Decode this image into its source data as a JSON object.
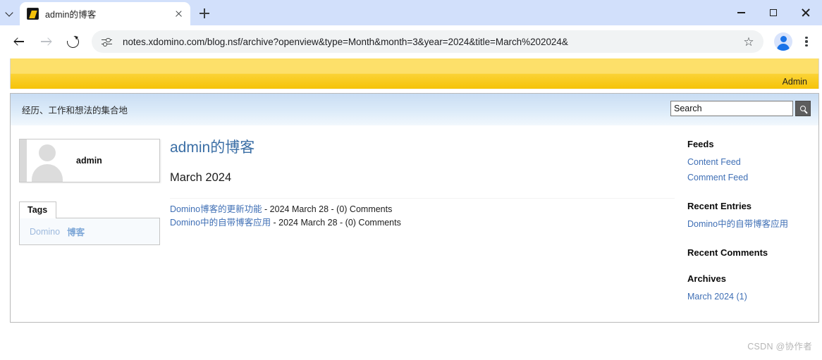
{
  "browser": {
    "tab": {
      "title": "admin的博客",
      "favicon": "domino-favicon"
    },
    "new_tab_label": "+",
    "window": {
      "minimize": "minimize-icon",
      "maximize": "maximize-icon",
      "close": "close-icon"
    },
    "toolbar": {
      "back": "back-arrow-icon",
      "forward": "forward-arrow-icon",
      "reload": "reload-icon",
      "site_info": "site-settings-icon",
      "url": "notes.xdomino.com/blog.nsf/archive?openview&type=Month&month=3&year=2024&title=March%202024&",
      "bookmark": "☆",
      "profile": "profile-avatar-icon",
      "menu": "kebab-menu-icon"
    }
  },
  "page": {
    "banner": {
      "user_label": "Admin",
      "color": "#fbd335"
    },
    "tagline": "经历、工作和想法的集合地",
    "search": {
      "value": "Search",
      "placeholder": "Search",
      "button_icon": "search-icon"
    },
    "profile_card": {
      "name": "admin",
      "avatar": "user-silhouette-icon"
    },
    "tags_panel": {
      "tab_label": "Tags",
      "tags": [
        {
          "label": "Domino"
        },
        {
          "label": "博客"
        }
      ]
    },
    "main": {
      "blog_title": "admin的博客",
      "month_title": "March 2024",
      "entries": [
        {
          "title": "Domino博客的更新功能",
          "meta": " - 2024 March 28 - (0) Comments"
        },
        {
          "title": "Domino中的自带博客应用",
          "meta": " - 2024 March 28 - (0) Comments"
        }
      ]
    },
    "sidebar": {
      "feeds_heading": "Feeds",
      "feeds": [
        {
          "label": "Content Feed"
        },
        {
          "label": "Comment Feed"
        }
      ],
      "recent_entries_heading": "Recent Entries",
      "recent_entries": [
        {
          "label": "Domino中的自带博客应用"
        }
      ],
      "recent_comments_heading": "Recent Comments",
      "recent_comments": [],
      "archives_heading": "Archives",
      "archives": [
        {
          "label": "March 2024 (1)"
        }
      ]
    },
    "watermark": "CSDN @协作者"
  }
}
